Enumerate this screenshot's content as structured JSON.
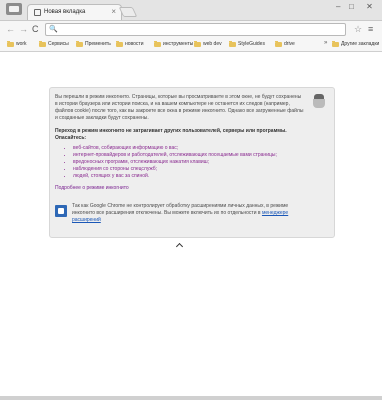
{
  "window": {
    "tab_title": "Новая вкладка",
    "tab_close": "×",
    "minimize": "‒",
    "maximize": "□",
    "close": "✕"
  },
  "toolbar": {
    "back": "←",
    "forward": "→",
    "reload": "C",
    "omnibox_icon": "🔍",
    "omnibox_value": "",
    "star": "☆",
    "menu": "≡"
  },
  "bookmarks": {
    "items": [
      {
        "label": "work"
      },
      {
        "label": "Сервисы"
      },
      {
        "label": "Пременить"
      },
      {
        "label": "новости"
      },
      {
        "label": "инструменты"
      },
      {
        "label": "web dev"
      },
      {
        "label": "StyleGuides"
      },
      {
        "label": "drive"
      }
    ],
    "more": "»",
    "other_label": "Другие закладки"
  },
  "incognito": {
    "para1": "Вы перешли в режим инкогнито. Страницы, которые вы просматриваете в этом окне, не будут сохранены в истории браузера или истории поиска, и на вашем компьютере не останется их следов (например, файлов cookie) после того, как вы закроете все окна в режиме инкогнито. Однако все загруженные файлы и созданные закладки будут сохранены.",
    "para2": "Переход в режим инкогнито не затрагивает других пользователей, серверы или программы. Опасайтесь:",
    "bullets": [
      "веб-сайтов, собирающих информацию о вас;",
      "интернет-провайдеров и работодателей, отслеживающих посещаемые вами страницы;",
      "вредоносных программ, отслеживающих нажатия клавиш;",
      "наблюдения со стороны спецслужб;",
      "людей, стоящих у вас за спиной."
    ],
    "more_link": "Подробнее о режиме инкогнито",
    "ext_text": "Так как Google Chrome не контролирует обработку расширениями личных данных, в режиме инкогнито все расширения отключены. Вы можете включить их по отдельности в",
    "ext_link": "менеджере расширений"
  },
  "colors": {
    "link_purple": "#7a2290",
    "link_blue": "#1a57b7",
    "folder": "#e8c35c",
    "extension_icon": "#2e68b6"
  }
}
